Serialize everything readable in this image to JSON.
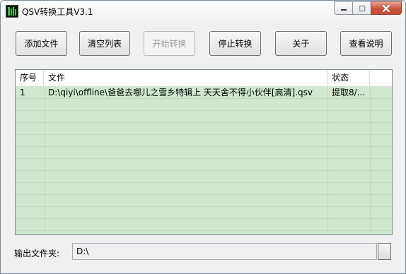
{
  "window": {
    "title": "QSV转换工具V3.1"
  },
  "toolbar": {
    "add_file": "添加文件",
    "clear_list": "清空列表",
    "start_convert": "开始转换",
    "stop_convert": "停止转换",
    "about": "关于",
    "help": "查看说明"
  },
  "list": {
    "headers": {
      "index": "序号",
      "file": "文件",
      "status": "状态"
    },
    "rows": [
      {
        "index": "1",
        "file": "D:\\qiyi\\offline\\爸爸去哪儿之雪乡特辑上 天天舍不得小伙伴[高清].qsv",
        "status": "提取8/..."
      }
    ]
  },
  "output": {
    "label": "输出文件夹:",
    "value": "D:\\"
  },
  "colors": {
    "list_bg": "#c8e6c9",
    "close_button": "#c7533b"
  }
}
